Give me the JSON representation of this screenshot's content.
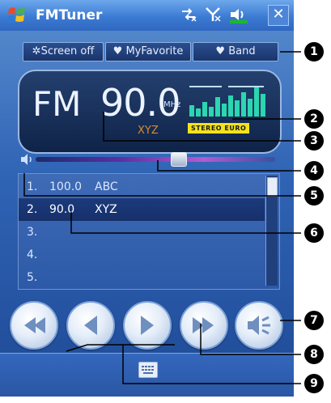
{
  "titlebar": {
    "app_title": "FMTuner",
    "status_icons": [
      "connectivity-icon",
      "signal-icon",
      "volume-icon",
      "battery-icon"
    ],
    "close_icon": "close-icon"
  },
  "toolbar": {
    "screen_off_label": "Screen off",
    "my_favorite_label": "MyFavorite",
    "band_label": "Band"
  },
  "display": {
    "band": "FM",
    "frequency": "90.0",
    "unit": "MHz",
    "station": "XYZ",
    "stereo_label": "STEREO EURO"
  },
  "volume": {
    "level_percent": 60
  },
  "stations": [
    {
      "index": "1.",
      "frequency": "100.0",
      "name": "ABC",
      "selected": false
    },
    {
      "index": "2.",
      "frequency": "90.0",
      "name": "XYZ",
      "selected": true
    },
    {
      "index": "3.",
      "frequency": "",
      "name": "",
      "selected": false
    },
    {
      "index": "4.",
      "frequency": "",
      "name": "",
      "selected": false
    },
    {
      "index": "5.",
      "frequency": "",
      "name": "",
      "selected": false
    }
  ],
  "controls": [
    "rewind-icon",
    "previous-icon",
    "next-icon",
    "fast-forward-icon",
    "speaker-icon"
  ],
  "callouts": [
    "1",
    "2",
    "3",
    "4",
    "5",
    "6",
    "7",
    "8",
    "9"
  ],
  "colors": {
    "title_bar": "#3c7bd3",
    "display_bg": "#13295a",
    "station_text": "#d98b2a",
    "stereo_badge": "#f4e31b",
    "callout_bg": "#000000"
  }
}
